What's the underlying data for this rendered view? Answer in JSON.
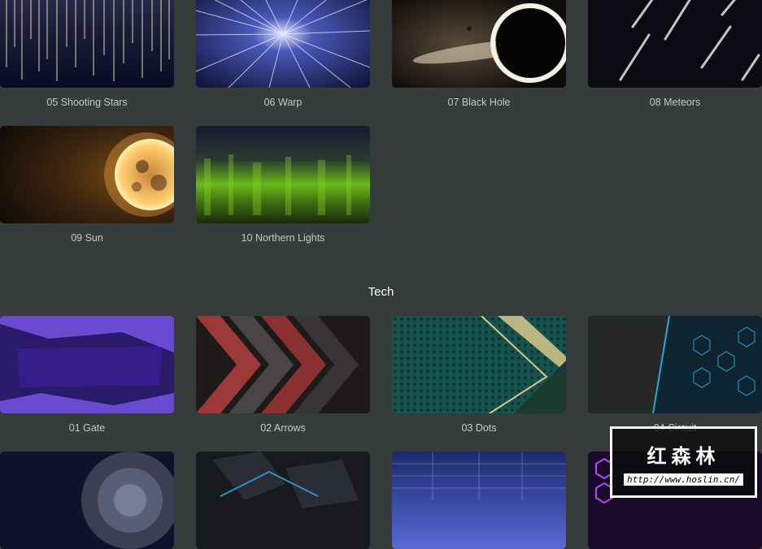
{
  "space": {
    "items": [
      {
        "label": "05 Shooting Stars"
      },
      {
        "label": "06 Warp"
      },
      {
        "label": "07 Black Hole"
      },
      {
        "label": "08 Meteors"
      },
      {
        "label": "09 Sun"
      },
      {
        "label": "10 Northern Lights"
      }
    ]
  },
  "tech": {
    "title": "Tech",
    "items": [
      {
        "label": "01 Gate"
      },
      {
        "label": "02 Arrows"
      },
      {
        "label": "03 Dots"
      },
      {
        "label": "04 Circuit"
      }
    ]
  },
  "watermark": {
    "title": "红森林",
    "url": "http://www.hoslin.cn/"
  },
  "colors": {
    "background": "#363b3b",
    "label": "#c5c9c9",
    "section_title": "#ffffff"
  }
}
